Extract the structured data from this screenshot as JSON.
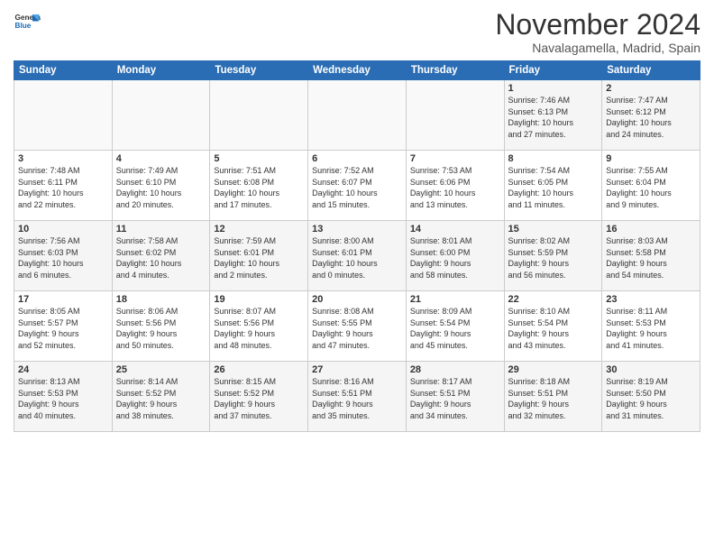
{
  "header": {
    "logo_line1": "General",
    "logo_line2": "Blue",
    "month_title": "November 2024",
    "location": "Navalagamella, Madrid, Spain"
  },
  "weekdays": [
    "Sunday",
    "Monday",
    "Tuesday",
    "Wednesday",
    "Thursday",
    "Friday",
    "Saturday"
  ],
  "weeks": [
    [
      {
        "day": "",
        "info": ""
      },
      {
        "day": "",
        "info": ""
      },
      {
        "day": "",
        "info": ""
      },
      {
        "day": "",
        "info": ""
      },
      {
        "day": "",
        "info": ""
      },
      {
        "day": "1",
        "info": "Sunrise: 7:46 AM\nSunset: 6:13 PM\nDaylight: 10 hours\nand 27 minutes."
      },
      {
        "day": "2",
        "info": "Sunrise: 7:47 AM\nSunset: 6:12 PM\nDaylight: 10 hours\nand 24 minutes."
      }
    ],
    [
      {
        "day": "3",
        "info": "Sunrise: 7:48 AM\nSunset: 6:11 PM\nDaylight: 10 hours\nand 22 minutes."
      },
      {
        "day": "4",
        "info": "Sunrise: 7:49 AM\nSunset: 6:10 PM\nDaylight: 10 hours\nand 20 minutes."
      },
      {
        "day": "5",
        "info": "Sunrise: 7:51 AM\nSunset: 6:08 PM\nDaylight: 10 hours\nand 17 minutes."
      },
      {
        "day": "6",
        "info": "Sunrise: 7:52 AM\nSunset: 6:07 PM\nDaylight: 10 hours\nand 15 minutes."
      },
      {
        "day": "7",
        "info": "Sunrise: 7:53 AM\nSunset: 6:06 PM\nDaylight: 10 hours\nand 13 minutes."
      },
      {
        "day": "8",
        "info": "Sunrise: 7:54 AM\nSunset: 6:05 PM\nDaylight: 10 hours\nand 11 minutes."
      },
      {
        "day": "9",
        "info": "Sunrise: 7:55 AM\nSunset: 6:04 PM\nDaylight: 10 hours\nand 9 minutes."
      }
    ],
    [
      {
        "day": "10",
        "info": "Sunrise: 7:56 AM\nSunset: 6:03 PM\nDaylight: 10 hours\nand 6 minutes."
      },
      {
        "day": "11",
        "info": "Sunrise: 7:58 AM\nSunset: 6:02 PM\nDaylight: 10 hours\nand 4 minutes."
      },
      {
        "day": "12",
        "info": "Sunrise: 7:59 AM\nSunset: 6:01 PM\nDaylight: 10 hours\nand 2 minutes."
      },
      {
        "day": "13",
        "info": "Sunrise: 8:00 AM\nSunset: 6:01 PM\nDaylight: 10 hours\nand 0 minutes."
      },
      {
        "day": "14",
        "info": "Sunrise: 8:01 AM\nSunset: 6:00 PM\nDaylight: 9 hours\nand 58 minutes."
      },
      {
        "day": "15",
        "info": "Sunrise: 8:02 AM\nSunset: 5:59 PM\nDaylight: 9 hours\nand 56 minutes."
      },
      {
        "day": "16",
        "info": "Sunrise: 8:03 AM\nSunset: 5:58 PM\nDaylight: 9 hours\nand 54 minutes."
      }
    ],
    [
      {
        "day": "17",
        "info": "Sunrise: 8:05 AM\nSunset: 5:57 PM\nDaylight: 9 hours\nand 52 minutes."
      },
      {
        "day": "18",
        "info": "Sunrise: 8:06 AM\nSunset: 5:56 PM\nDaylight: 9 hours\nand 50 minutes."
      },
      {
        "day": "19",
        "info": "Sunrise: 8:07 AM\nSunset: 5:56 PM\nDaylight: 9 hours\nand 48 minutes."
      },
      {
        "day": "20",
        "info": "Sunrise: 8:08 AM\nSunset: 5:55 PM\nDaylight: 9 hours\nand 47 minutes."
      },
      {
        "day": "21",
        "info": "Sunrise: 8:09 AM\nSunset: 5:54 PM\nDaylight: 9 hours\nand 45 minutes."
      },
      {
        "day": "22",
        "info": "Sunrise: 8:10 AM\nSunset: 5:54 PM\nDaylight: 9 hours\nand 43 minutes."
      },
      {
        "day": "23",
        "info": "Sunrise: 8:11 AM\nSunset: 5:53 PM\nDaylight: 9 hours\nand 41 minutes."
      }
    ],
    [
      {
        "day": "24",
        "info": "Sunrise: 8:13 AM\nSunset: 5:53 PM\nDaylight: 9 hours\nand 40 minutes."
      },
      {
        "day": "25",
        "info": "Sunrise: 8:14 AM\nSunset: 5:52 PM\nDaylight: 9 hours\nand 38 minutes."
      },
      {
        "day": "26",
        "info": "Sunrise: 8:15 AM\nSunset: 5:52 PM\nDaylight: 9 hours\nand 37 minutes."
      },
      {
        "day": "27",
        "info": "Sunrise: 8:16 AM\nSunset: 5:51 PM\nDaylight: 9 hours\nand 35 minutes."
      },
      {
        "day": "28",
        "info": "Sunrise: 8:17 AM\nSunset: 5:51 PM\nDaylight: 9 hours\nand 34 minutes."
      },
      {
        "day": "29",
        "info": "Sunrise: 8:18 AM\nSunset: 5:51 PM\nDaylight: 9 hours\nand 32 minutes."
      },
      {
        "day": "30",
        "info": "Sunrise: 8:19 AM\nSunset: 5:50 PM\nDaylight: 9 hours\nand 31 minutes."
      }
    ]
  ]
}
